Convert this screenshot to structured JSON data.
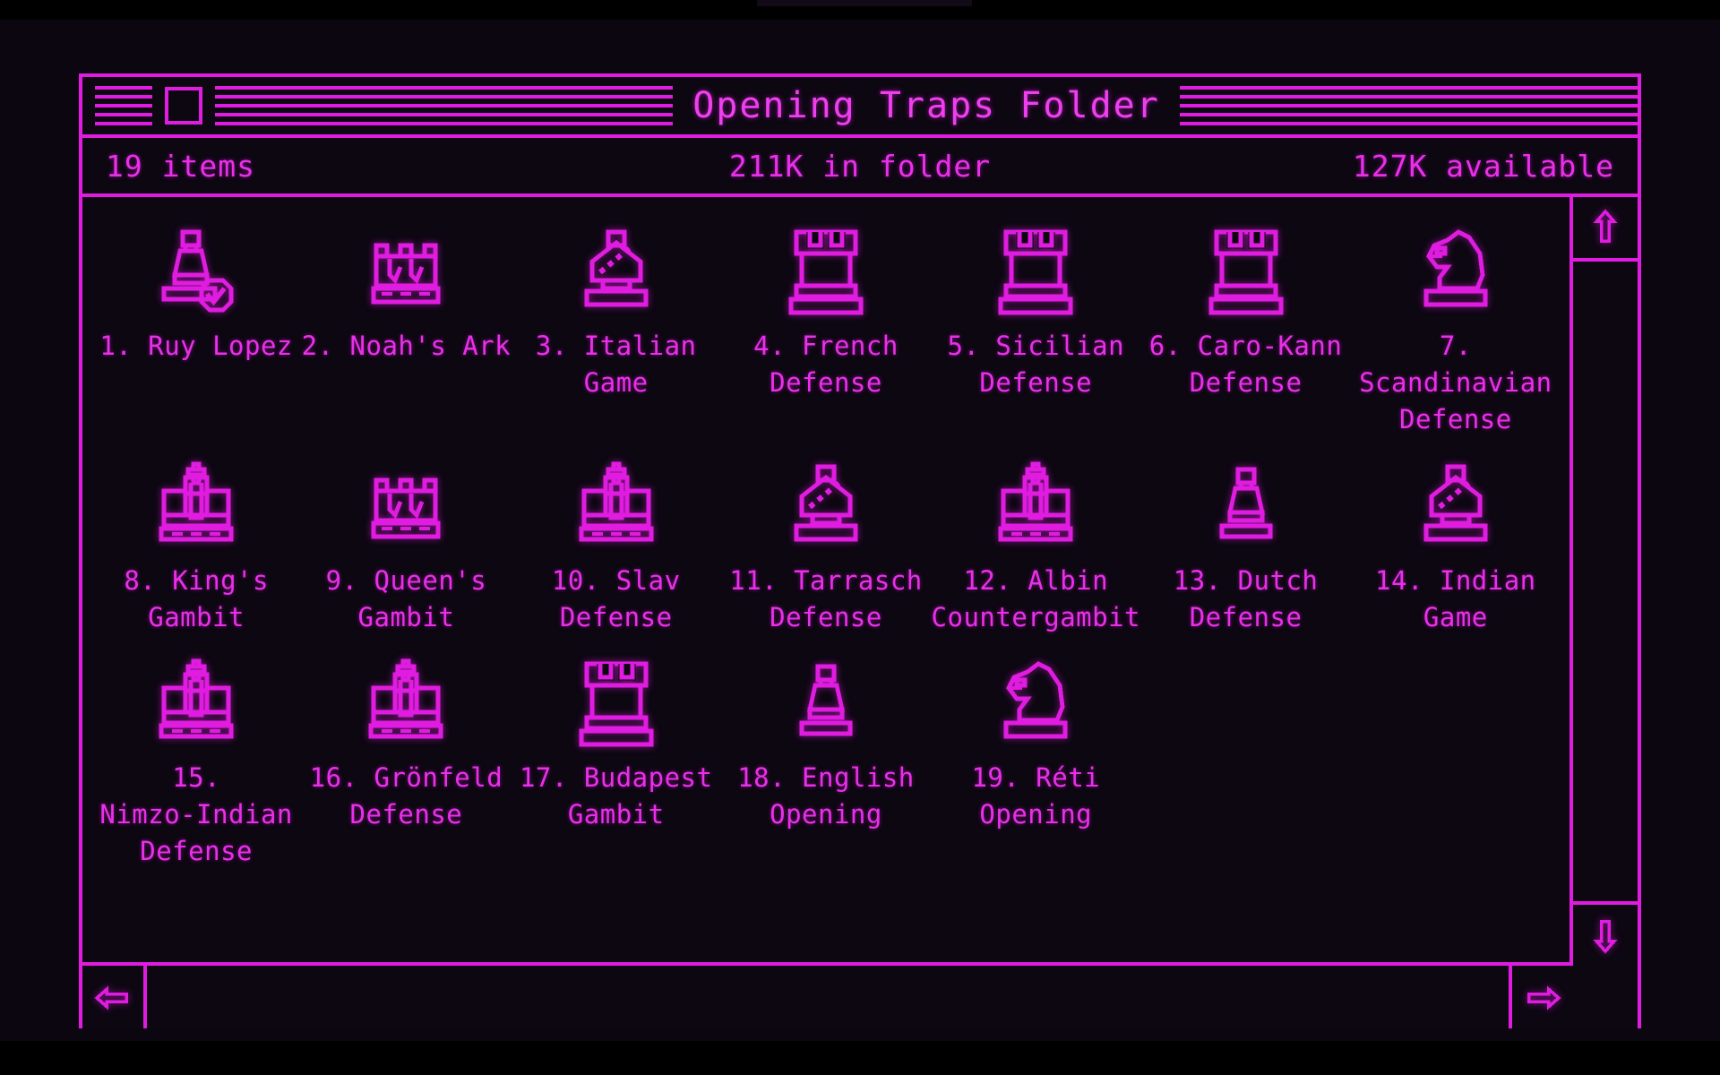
{
  "theme": {
    "background": "#000000",
    "accent": "#e01ce0",
    "text": "#e92fe9",
    "window_bg": "#0d0712"
  },
  "window": {
    "title": "Opening Traps Folder",
    "close_box": "close-box",
    "titlebar_stripes": "stripes"
  },
  "status": {
    "items": "19 items",
    "folder_size": "211K in folder",
    "available": "127K available"
  },
  "scrollbars": {
    "up_arrow": "arrow-up-icon",
    "down_arrow": "arrow-down-icon",
    "left_arrow": "arrow-left-icon",
    "right_arrow": "arrow-right-icon"
  },
  "files": [
    {
      "label": "1. Ruy Lopez",
      "icon": "pawn-checked-icon"
    },
    {
      "label": "2. Noah's Ark",
      "icon": "crown-icon"
    },
    {
      "label": "3. Italian Game",
      "icon": "bishop-icon"
    },
    {
      "label": "4. French\nDefense",
      "icon": "rook-icon"
    },
    {
      "label": "5. Sicilian\nDefense",
      "icon": "rook-icon"
    },
    {
      "label": "6. Caro-Kann\nDefense",
      "icon": "rook-icon"
    },
    {
      "label": "7. Scandinavian\nDefense",
      "icon": "knight-icon"
    },
    {
      "label": "8. King's\nGambit",
      "icon": "king-icon"
    },
    {
      "label": "9. Queen's\nGambit",
      "icon": "crown-icon"
    },
    {
      "label": "10. Slav\nDefense",
      "icon": "king-icon"
    },
    {
      "label": "11. Tarrasch\nDefense",
      "icon": "bishop-icon"
    },
    {
      "label": "12. Albin\nCountergambit",
      "icon": "king-icon"
    },
    {
      "label": "13. Dutch\nDefense",
      "icon": "pawn-icon"
    },
    {
      "label": "14. Indian Game",
      "icon": "bishop-icon"
    },
    {
      "label": "15.\nNimzo-Indian\nDefense",
      "icon": "king-icon"
    },
    {
      "label": "16. Grönfeld\nDefense",
      "icon": "king-icon"
    },
    {
      "label": "17. Budapest\nGambit",
      "icon": "rook-icon"
    },
    {
      "label": "18. English\nOpening",
      "icon": "pawn-icon"
    },
    {
      "label": "19. Réti Opening",
      "icon": "knight-icon"
    }
  ]
}
